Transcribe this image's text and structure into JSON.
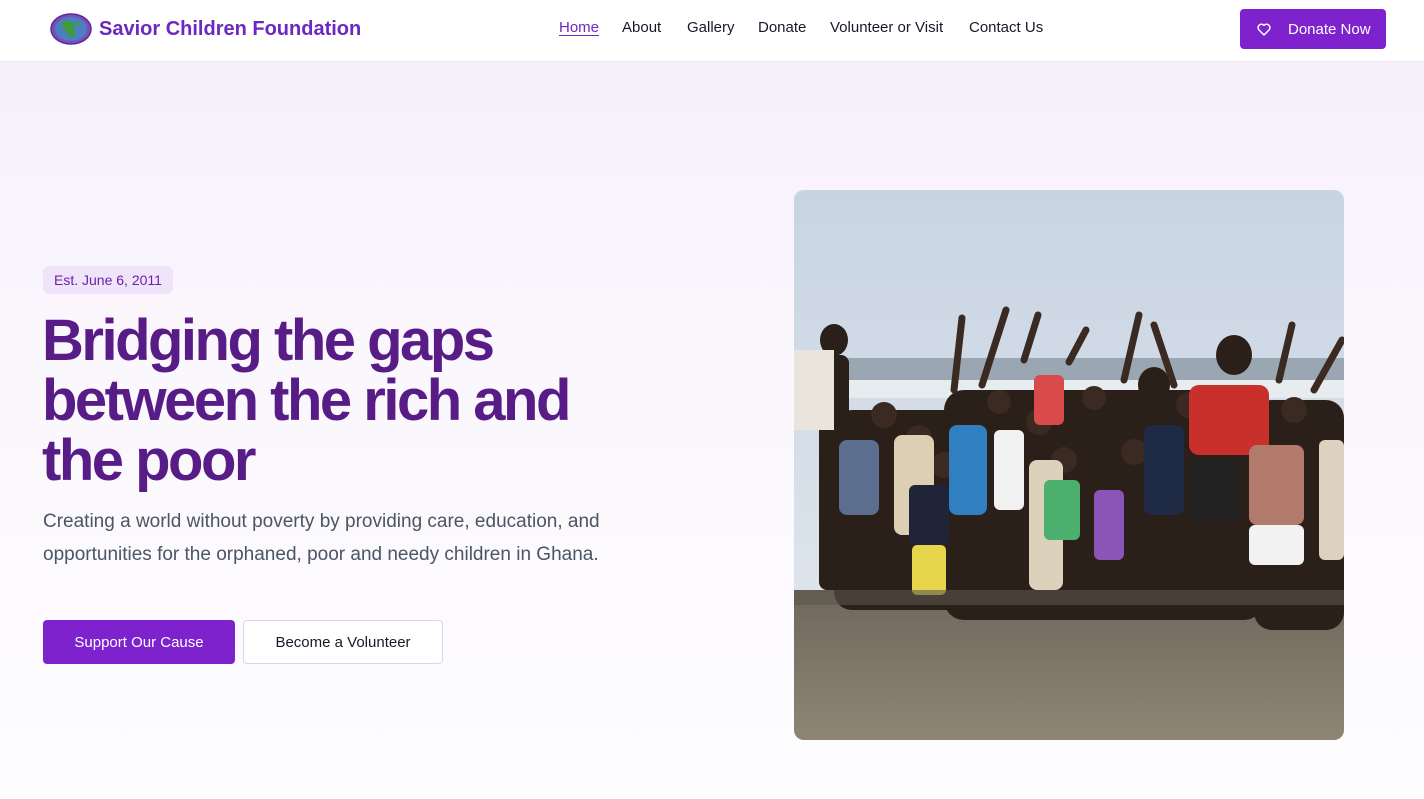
{
  "brand": {
    "name": "Savior Children Foundation",
    "logo_icon": "globe-logo-icon"
  },
  "nav": {
    "items": [
      {
        "label": "Home",
        "active": true
      },
      {
        "label": "About",
        "active": false
      },
      {
        "label": "Gallery",
        "active": false
      },
      {
        "label": "Donate",
        "active": false
      },
      {
        "label": "Volunteer or Visit",
        "active": false
      },
      {
        "label": "Contact Us",
        "active": false
      }
    ],
    "cta_label": "Donate Now",
    "cta_icon": "heart-icon"
  },
  "hero": {
    "badge": "Est. June 6, 2011",
    "title_lines": [
      "Bridging the gaps",
      "between the rich and",
      "the poor"
    ],
    "subtitle": "Creating a world without poverty by providing care, education, and opportunities for the orphaned, poor and needy children in Ghana.",
    "primary_button": "Support Our Cause",
    "secondary_button": "Become a Volunteer"
  },
  "colors": {
    "brand_purple": "#6d28c2",
    "button_purple": "#7e22ce",
    "title_purple": "#581c87",
    "badge_bg": "#f0e4fb"
  }
}
